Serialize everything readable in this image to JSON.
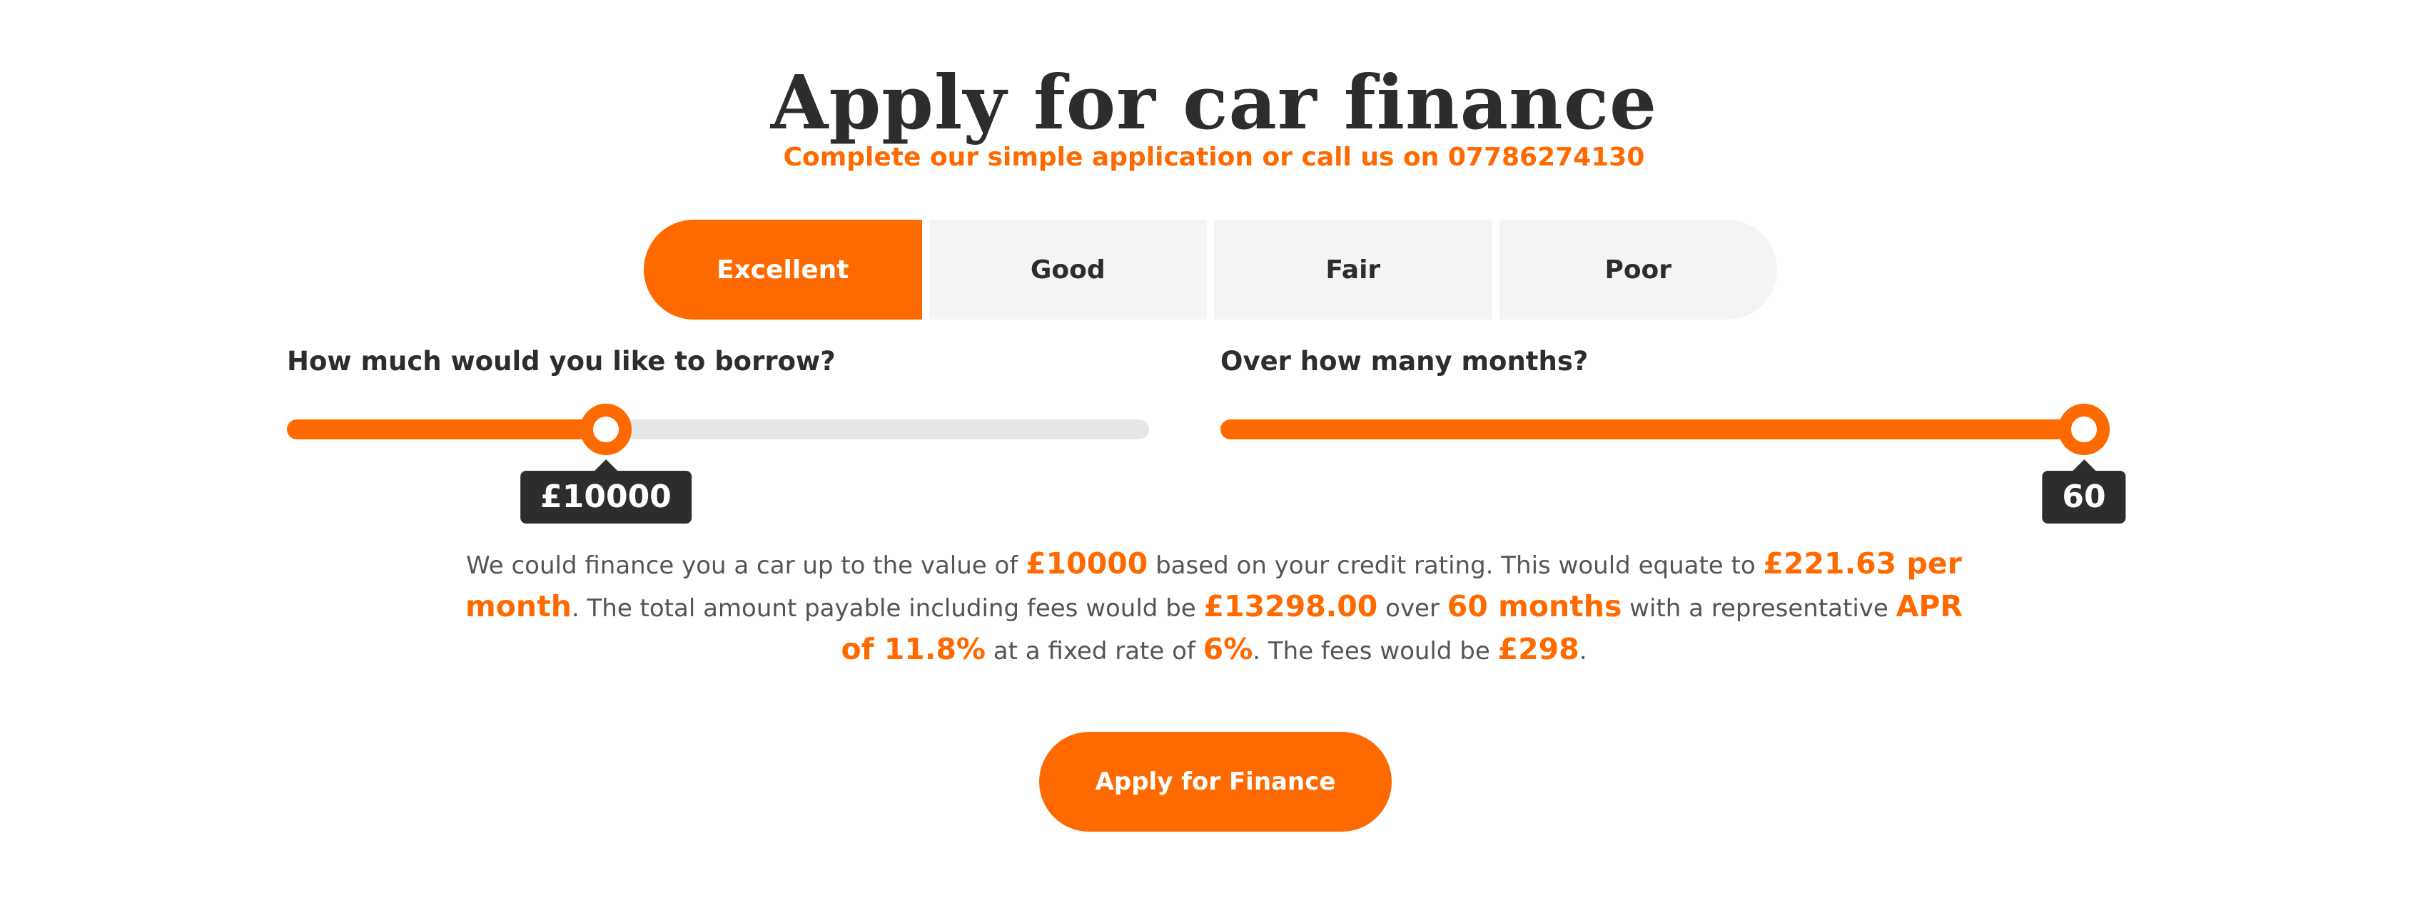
{
  "header": {
    "title": "Apply for car finance",
    "subtitle": "Complete our simple application or call us on 07786274130"
  },
  "credit_tabs": {
    "items": [
      "Excellent",
      "Good",
      "Fair",
      "Poor"
    ],
    "selected": "Excellent"
  },
  "borrow_slider": {
    "label": "How much would you like to borrow?",
    "value_display": "£10000",
    "fill_fraction": 0.37
  },
  "months_slider": {
    "label": "Over how many months?",
    "value_display": "60",
    "fill_fraction": 1.0
  },
  "summary": {
    "t1": "We could finance you a car up to the value of ",
    "amount": "£10000",
    "t2": " based on your credit rating. This would equate to ",
    "monthly": "£221.63 per month",
    "t3": ". The total amount payable including fees would be ",
    "total": "£13298.00",
    "t4": " over ",
    "term": "60 months",
    "t5": " with a representative ",
    "apr": "APR of 11.8%",
    "t6": " at a fixed rate of ",
    "rate": "6%",
    "t7": ". The fees would be ",
    "fees": "£298",
    "t8": "."
  },
  "apply_button": {
    "label": "Apply for Finance"
  },
  "colors": {
    "accent": "#ff6a00",
    "text_dark": "#2d2d2d",
    "text_muted": "#555555",
    "tab_inactive_bg": "#f4f4f4",
    "track_bg": "#e6e6e6"
  }
}
